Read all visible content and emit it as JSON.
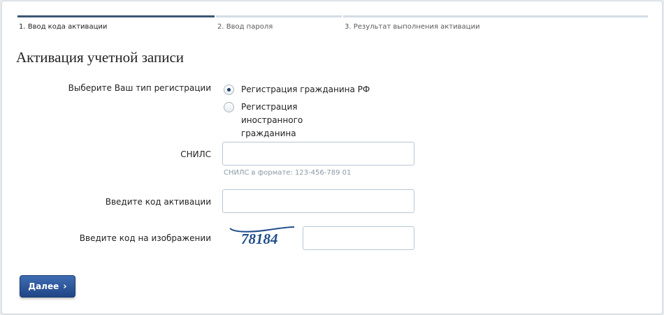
{
  "steps": [
    {
      "label": "1. Ввод кода активации",
      "active": true
    },
    {
      "label": "2. Ввод пароля",
      "active": false
    },
    {
      "label": "3. Результат выполнения активации",
      "active": false
    }
  ],
  "page_title": "Активация учетной записи",
  "registration": {
    "label": "Выберите Ваш тип регистрации",
    "options": [
      {
        "label": "Регистрация гражданина РФ",
        "checked": true
      },
      {
        "label": "Регистрация иностранного гражданина",
        "checked": false
      }
    ]
  },
  "snils": {
    "label": "СНИЛС",
    "value": "",
    "hint": "СНИЛС в формате: 123-456-789 01"
  },
  "activation_code": {
    "label": "Введите код активации",
    "value": ""
  },
  "captcha": {
    "label": "Введите код на изображении",
    "image_text": "78184",
    "value": ""
  },
  "next_button": {
    "label": "Далее",
    "icon": "chevron-right-icon"
  },
  "colors": {
    "accent": "#3d5773",
    "button": "#2a56a0",
    "captcha_text": "#1f4c8a",
    "hint": "#8a9aa8"
  }
}
